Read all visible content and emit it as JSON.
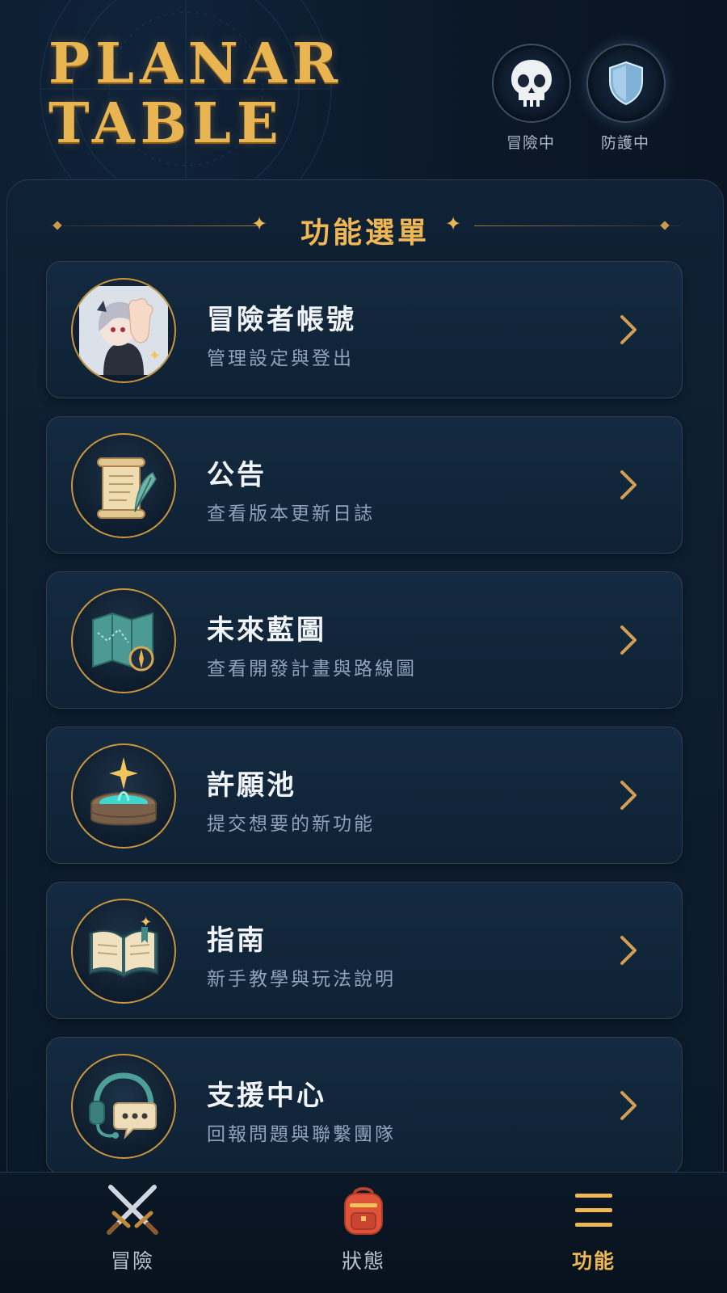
{
  "app": {
    "logo_line1": "PLANAR",
    "logo_line2": "TABLE"
  },
  "status": [
    {
      "label": "冒險中",
      "icon": "skull-icon"
    },
    {
      "label": "防護中",
      "icon": "shield-icon"
    }
  ],
  "section": {
    "title": "功能選單"
  },
  "menu": [
    {
      "title": "冒險者帳號",
      "subtitle": "管理設定與登出",
      "icon": "avatar-icon"
    },
    {
      "title": "公告",
      "subtitle": "查看版本更新日誌",
      "icon": "scroll-quill-icon"
    },
    {
      "title": "未來藍圖",
      "subtitle": "查看開發計畫與路線圖",
      "icon": "map-compass-icon"
    },
    {
      "title": "許願池",
      "subtitle": "提交想要的新功能",
      "icon": "wishing-well-icon"
    },
    {
      "title": "指南",
      "subtitle": "新手教學與玩法說明",
      "icon": "open-book-icon"
    },
    {
      "title": "支援中心",
      "subtitle": "回報問題與聯繫團隊",
      "icon": "headset-chat-icon"
    }
  ],
  "nav": [
    {
      "label": "冒險",
      "icon": "crossed-swords-icon",
      "active": false
    },
    {
      "label": "狀態",
      "icon": "backpack-icon",
      "active": false
    },
    {
      "label": "功能",
      "icon": "hamburger-menu-icon",
      "active": true
    }
  ],
  "colors": {
    "accent_gold": "#efb853",
    "background": "#0b1828"
  }
}
